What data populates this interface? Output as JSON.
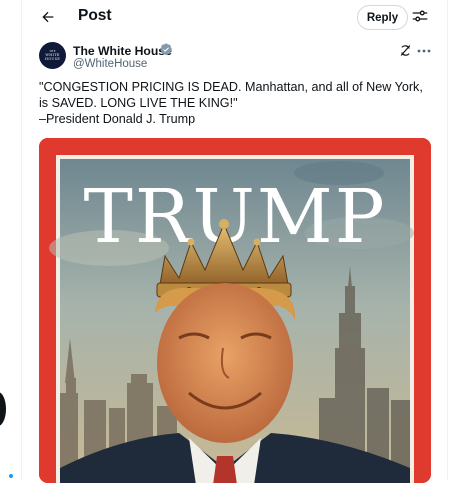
{
  "header": {
    "title": "Post",
    "reply_label": "Reply",
    "back_icon": "arrow-left-icon",
    "settings_icon": "sliders-icon"
  },
  "author": {
    "name": "The White House",
    "handle": "@WhiteHouse",
    "verified": true,
    "avatar_text_top": "THE",
    "avatar_text_mid": "WHITE",
    "avatar_text_bottom": "HOUSE",
    "grok_icon": "grok-icon",
    "more_icon": "more-icon"
  },
  "tweet": {
    "line1": "\"CONGESTION PRICING IS DEAD. Manhattan, and all of New York, is SAVED. LONG LIVE THE KING!\"",
    "line2": "–President Donald J. Trump"
  },
  "media": {
    "cover_title": "TRUMP",
    "border_color": "#e0392d"
  },
  "colors": {
    "accent": "#1d9bf0",
    "text": "#0f1419",
    "muted": "#536471"
  }
}
